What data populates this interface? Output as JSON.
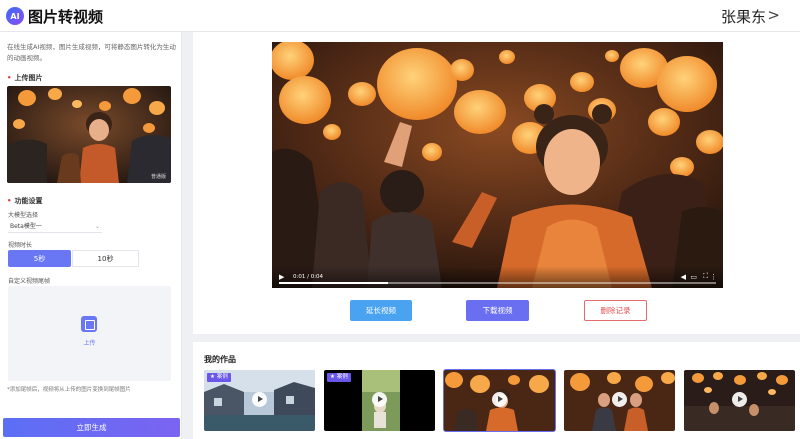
{
  "header": {
    "logo_text": "AI",
    "title": "图片转视频",
    "user_name": "张果东",
    "user_arrow": ">"
  },
  "sidebar": {
    "description": "在线生成AI视频，图片生成视频，可将静态图片转化为生动的动画视频。",
    "upload_label": "上传图片",
    "settings_label": "功能设置",
    "model_label": "大模型选择",
    "model_value": "Beta模型一",
    "duration_label": "视频时长",
    "duration_options": [
      "5秒",
      "10秒"
    ],
    "selected_duration": "5秒",
    "custom_frame_label": "自定义视频尾帧",
    "upload_button": "上传",
    "hint": "*添加尾帧后，视频将从上传的图片变换到尾帧图片",
    "generate_button": "立即生成",
    "watermark": "普通版"
  },
  "player": {
    "time": "0:01 / 0:04",
    "progress": 0.25
  },
  "actions": {
    "extend": "延长视频",
    "download": "下载视频",
    "delete": "删除记录"
  },
  "works": {
    "title": "我的作品",
    "items": [
      {
        "badge": "案例",
        "scene": "canal"
      },
      {
        "badge": "案例",
        "scene": "park"
      },
      {
        "badge": "",
        "scene": "lantern-girl",
        "selected": true
      },
      {
        "badge": "",
        "scene": "lantern-couple"
      },
      {
        "badge": "",
        "scene": "lantern-night"
      }
    ]
  },
  "colors": {
    "accent": "#6a6ff2",
    "accent_blue": "#4aa3f0",
    "danger": "#e35050",
    "lantern": "#f59a3a"
  }
}
